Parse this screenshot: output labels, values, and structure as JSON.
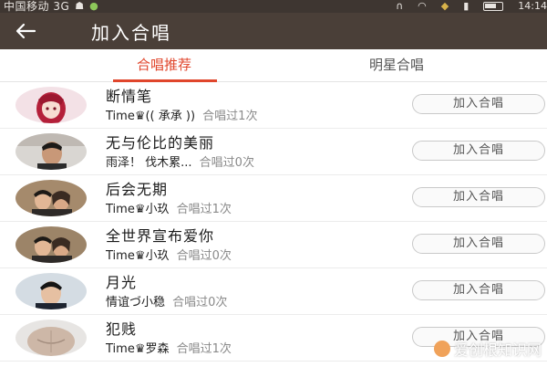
{
  "status_bar": {
    "carrier": "中国移动 3G",
    "time": "14:14"
  },
  "header": {
    "title": "加入合唱",
    "back_icon": "back-arrow-icon"
  },
  "tabs": [
    {
      "label": "合唱推荐",
      "active": true
    },
    {
      "label": "明星合唱",
      "active": false
    }
  ],
  "colors": {
    "accent": "#e0462c",
    "header_bg": "#4a3f38",
    "statusbar_bg": "#3e3631"
  },
  "items": [
    {
      "song": "断情笔",
      "singer": "Time♛(( 承承 ))",
      "count": "合唱过1次",
      "button": "加入合唱",
      "avatar": "anime-girl-avatar"
    },
    {
      "song": "无与伦比的美丽",
      "singer": "雨泽！ 伐木累...",
      "count": "合唱过0次",
      "button": "加入合唱",
      "avatar": "man-portrait-avatar"
    },
    {
      "song": "后会无期",
      "singer": "Time♛小玖",
      "count": "合唱过1次",
      "button": "加入合唱",
      "avatar": "couple-photo-avatar"
    },
    {
      "song": "全世界宣布爱你",
      "singer": "Time♛小玖",
      "count": "合唱过0次",
      "button": "加入合唱",
      "avatar": "couple-photo-avatar"
    },
    {
      "song": "月光",
      "singer": "情谊づ小稳",
      "count": "合唱过0次",
      "button": "加入合唱",
      "avatar": "young-man-avatar"
    },
    {
      "song": "犯贱",
      "singer": "Time♛罗森",
      "count": "合唱过1次",
      "button": "加入合唱",
      "avatar": "torso-photo-avatar"
    }
  ],
  "watermark": "爱创根知识网"
}
